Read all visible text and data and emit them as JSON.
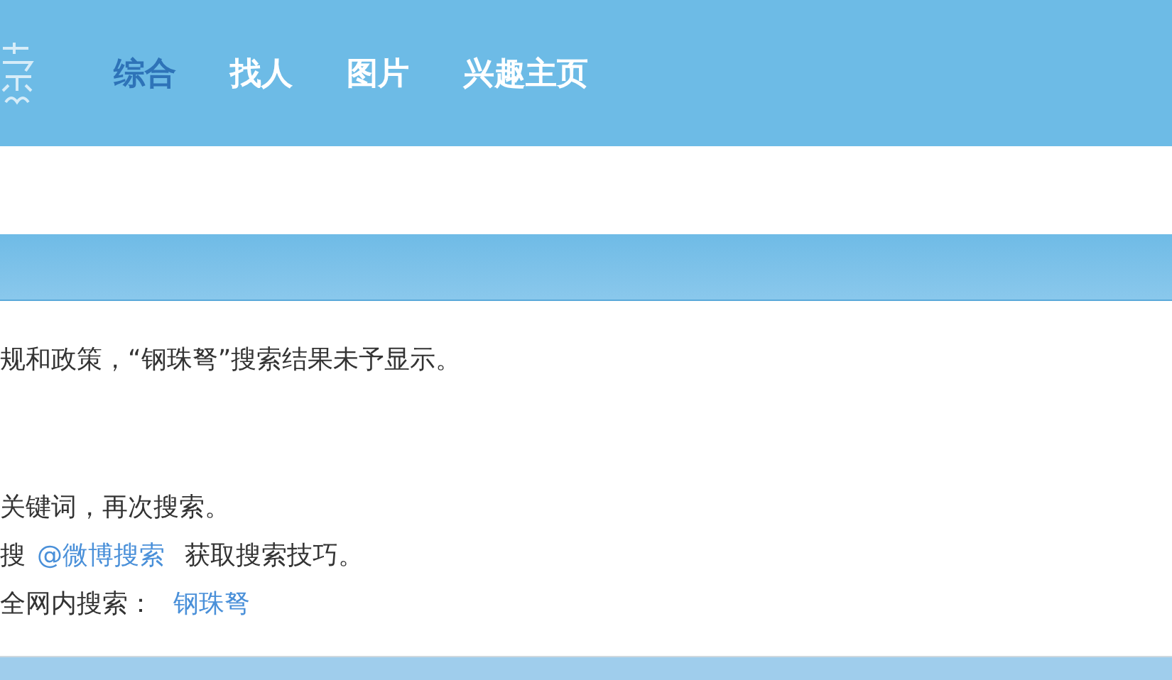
{
  "nav": {
    "tabs": [
      {
        "label": "综合",
        "selected": true
      },
      {
        "label": "找人",
        "selected": false
      },
      {
        "label": "图片",
        "selected": false
      },
      {
        "label": "兴趣主页",
        "selected": false
      }
    ]
  },
  "notice": {
    "message": "规和政策，“钢珠弩”搜索结果未予显示。",
    "tips": [
      {
        "kind": "plain",
        "text": "关键词，再次搜索。"
      },
      {
        "kind": "link",
        "before": "搜",
        "link": "@微博搜索",
        "after": "获取搜索技巧。"
      },
      {
        "kind": "link",
        "before": "全网内搜索：",
        "link": "钢珠弩"
      }
    ]
  }
}
